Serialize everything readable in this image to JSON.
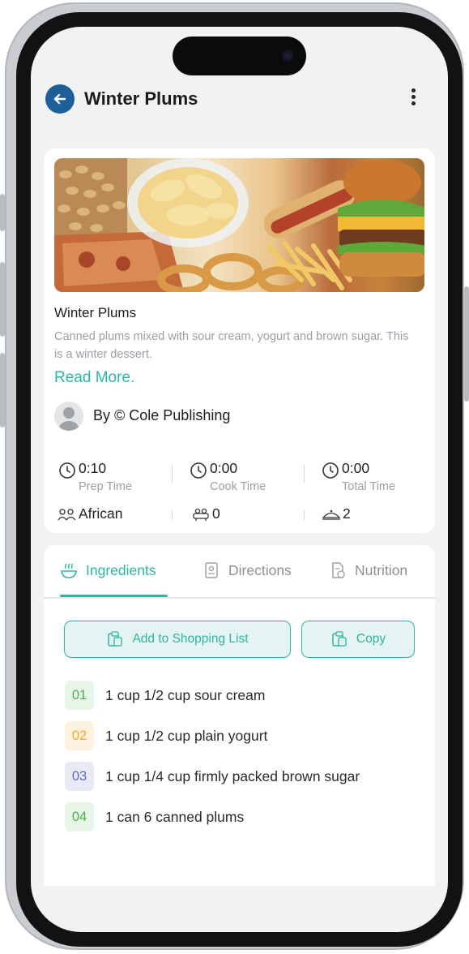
{
  "header": {
    "title": "Winter Plums"
  },
  "recipe": {
    "name": "Winter Plums",
    "description": "Canned plums mixed with sour cream, yogurt and brown sugar. This is a winter dessert.",
    "read_more": "Read More.",
    "author": "By © Cole Publishing"
  },
  "times": [
    {
      "value": "0:10",
      "label": "Prep Time"
    },
    {
      "value": "0:00",
      "label": "Cook Time"
    },
    {
      "value": "0:00",
      "label": "Total Time"
    }
  ],
  "meta": [
    {
      "icon": "cuisine-icon",
      "value": "African"
    },
    {
      "icon": "servings-icon",
      "value": "0"
    },
    {
      "icon": "dish-icon",
      "value": "2"
    }
  ],
  "tabs": [
    {
      "label": "Ingredients",
      "icon": "ingredients-icon",
      "active": true
    },
    {
      "label": "Directions",
      "icon": "directions-icon",
      "active": false
    },
    {
      "label": "Nutrition",
      "icon": "nutrition-icon",
      "active": false
    }
  ],
  "actions": {
    "add_to_shopping_list": "Add to Shopping List",
    "copy": "Copy"
  },
  "ingredients": [
    {
      "num": "01",
      "text": "1 cup 1/2 cup sour cream",
      "color": "#4caf50",
      "bg": "#e8f5e9"
    },
    {
      "num": "02",
      "text": "1 cup 1/2 cup plain yogurt",
      "color": "#f5a623",
      "bg": "#fdf1e0"
    },
    {
      "num": "03",
      "text": "1 cup 1/4 cup firmly packed brown sugar",
      "color": "#5c6bc0",
      "bg": "#e8eaf6"
    },
    {
      "num": "04",
      "text": "1 can 6 canned plums",
      "color": "#4caf50",
      "bg": "#e8f5e9"
    }
  ],
  "colors": {
    "accent": "#2bb7a2",
    "back_button": "#1f5f99"
  }
}
